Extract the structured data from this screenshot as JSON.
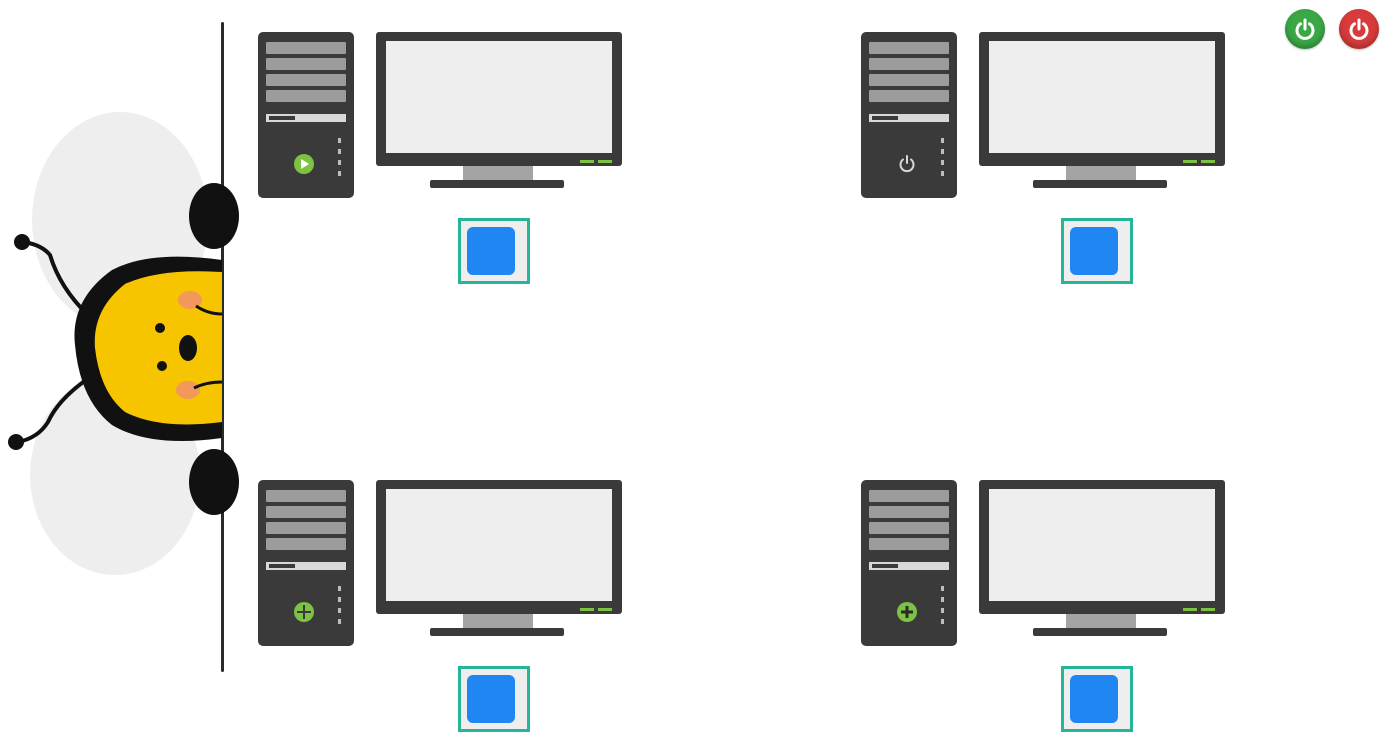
{
  "colors": {
    "background": "#ffffff",
    "computer_body": "#3a3a3a",
    "screen": "#eeeeee",
    "select_border": "#26b597",
    "select_fill": "#1f86f2",
    "power_on": "#3aa845",
    "power_off": "#d83b3b",
    "bee_yellow": "#f9c800"
  },
  "controls": {
    "power_on_icon": "power-on-icon",
    "power_off_icon": "power-off-icon"
  },
  "stations": [
    {
      "id": "top-left",
      "tower_button_icon": "play-icon",
      "tower_button_color": "#7dc242"
    },
    {
      "id": "top-right",
      "tower_button_icon": "power-icon",
      "tower_button_color": "#d8d8d8"
    },
    {
      "id": "bottom-left",
      "tower_button_icon": "crosshair-icon",
      "tower_button_color": "#7dc242"
    },
    {
      "id": "bottom-right",
      "tower_button_icon": "plus-icon",
      "tower_button_color": "#7dc242"
    }
  ]
}
